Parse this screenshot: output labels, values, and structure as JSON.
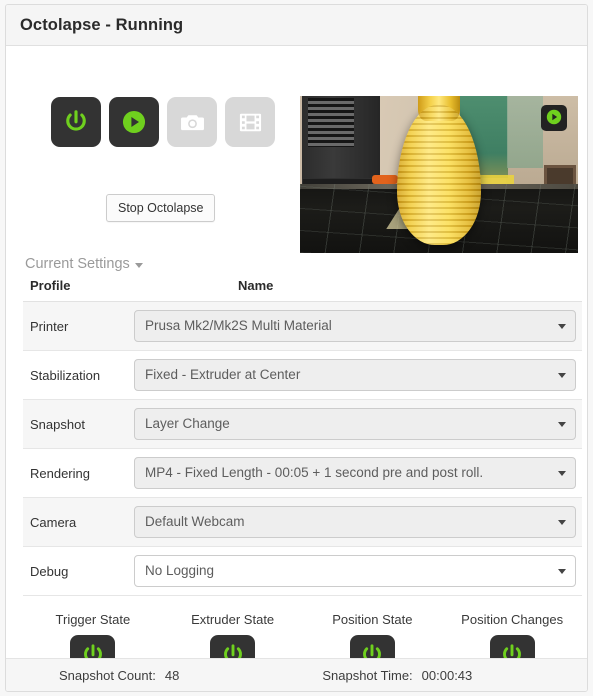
{
  "header": {
    "title": "Octolapse - Running"
  },
  "controls": {
    "buttons": [
      {
        "name": "power-icon",
        "label": "Power",
        "state": "enabled"
      },
      {
        "name": "play-icon",
        "label": "Start",
        "state": "enabled"
      },
      {
        "name": "camera-icon",
        "label": "Take Snapshot",
        "state": "disabled"
      },
      {
        "name": "film-icon",
        "label": "Render Video",
        "state": "disabled"
      }
    ],
    "stop_label": "Stop Octolapse"
  },
  "webcam": {
    "play_badge_icon": "play-circle-icon"
  },
  "settings": {
    "toggle_label": "Current Settings",
    "columns": [
      "Profile",
      "Name"
    ],
    "rows": [
      {
        "profile": "Printer",
        "value": "Prusa Mk2/Mk2S Multi Material"
      },
      {
        "profile": "Stabilization",
        "value": "Fixed - Extruder at Center"
      },
      {
        "profile": "Snapshot",
        "value": "Layer Change"
      },
      {
        "profile": "Rendering",
        "value": "MP4 - Fixed Length - 00:05 + 1 second pre and post roll."
      },
      {
        "profile": "Camera",
        "value": "Default Webcam"
      },
      {
        "profile": "Debug",
        "value": "No Logging"
      }
    ]
  },
  "states": [
    {
      "label": "Trigger State",
      "icon": "power-icon"
    },
    {
      "label": "Extruder State",
      "icon": "power-icon"
    },
    {
      "label": "Position State",
      "icon": "power-icon"
    },
    {
      "label": "Position Changes",
      "icon": "power-icon"
    }
  ],
  "footer": {
    "snapshot_count_label": "Snapshot Count:",
    "snapshot_count_value": "48",
    "snapshot_time_label": "Snapshot Time:",
    "snapshot_time_value": "00:00:43"
  },
  "colors": {
    "accent_green": "#6fd01e",
    "button_dark": "#333333",
    "button_disabled": "#d8d8d8"
  }
}
